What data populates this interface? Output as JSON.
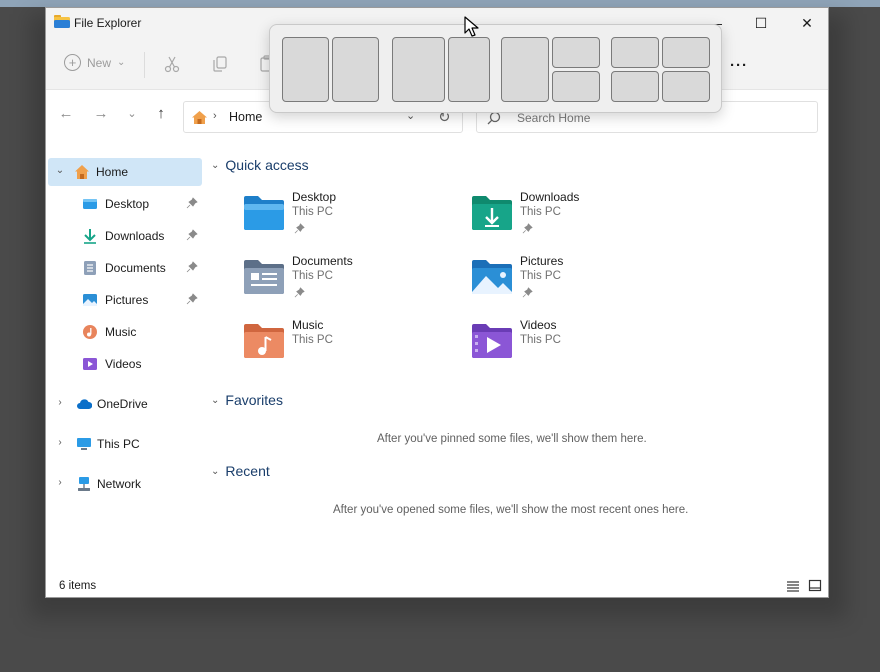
{
  "window": {
    "title": "File Explorer",
    "minimize_glyph": "—",
    "maximize_glyph": "☐",
    "close_glyph": "✕"
  },
  "toolbar": {
    "new_label": "New",
    "new_chevron": "⌄",
    "more_label": "···",
    "icons": [
      "cut-icon",
      "copy-icon",
      "paste-icon"
    ]
  },
  "nav": {
    "back": "←",
    "forward": "→",
    "recent": "⌄",
    "up": "↑"
  },
  "address": {
    "location": "Home",
    "separator": "›",
    "dropdown": "⌄",
    "refresh": "↻"
  },
  "search": {
    "placeholder": "Search Home"
  },
  "sidebar": {
    "items": [
      {
        "label": "Home",
        "icon": "home-icon",
        "selected": true,
        "chevron": "⌄"
      },
      {
        "label": "Desktop",
        "icon": "desktop-folder-icon",
        "pinned": true
      },
      {
        "label": "Downloads",
        "icon": "download-icon",
        "pinned": true
      },
      {
        "label": "Documents",
        "icon": "documents-icon",
        "pinned": true
      },
      {
        "label": "Pictures",
        "icon": "pictures-icon",
        "pinned": true
      },
      {
        "label": "Music",
        "icon": "music-icon",
        "pinned": false
      },
      {
        "label": "Videos",
        "icon": "videos-icon",
        "pinned": false
      },
      {
        "label": "OneDrive",
        "icon": "onedrive-icon",
        "chevron": "›"
      },
      {
        "label": "This PC",
        "icon": "this-pc-icon",
        "chevron": "›"
      },
      {
        "label": "Network",
        "icon": "network-icon",
        "chevron": "›"
      }
    ]
  },
  "main": {
    "quick_access": {
      "title": "Quick access",
      "chevron": "⌄",
      "items": [
        {
          "name": "Desktop",
          "location": "This PC",
          "pinned": true,
          "icon": "desktop-folder-icon"
        },
        {
          "name": "Downloads",
          "location": "This PC",
          "pinned": true,
          "icon": "downloads-folder-icon"
        },
        {
          "name": "Documents",
          "location": "This PC",
          "pinned": true,
          "icon": "documents-folder-icon"
        },
        {
          "name": "Pictures",
          "location": "This PC",
          "pinned": true,
          "icon": "pictures-folder-icon"
        },
        {
          "name": "Music",
          "location": "This PC",
          "pinned": false,
          "icon": "music-folder-icon"
        },
        {
          "name": "Videos",
          "location": "This PC",
          "pinned": false,
          "icon": "videos-folder-icon"
        }
      ]
    },
    "favorites": {
      "title": "Favorites",
      "chevron": "⌄",
      "empty_message": "After you've pinned some files, we'll show them here."
    },
    "recent": {
      "title": "Recent",
      "chevron": "⌄",
      "empty_message": "After you've opened some files, we'll show the most recent ones here."
    }
  },
  "status": {
    "item_count": "6 items",
    "views": [
      "details-view-icon",
      "tiles-view-icon"
    ]
  },
  "snap_layouts": {
    "layouts": [
      "two-column-equal",
      "two-column-wide-left",
      "one-left-two-right",
      "four-grid"
    ]
  },
  "colors": {
    "accent": "#0067c0",
    "selection": "#d0e6f7",
    "section_header": "#1a3e6b",
    "folder_blue": "#2b9be6",
    "folder_teal": "#17a589",
    "folder_orange": "#e8845c",
    "folder_purple": "#8b56d6"
  }
}
